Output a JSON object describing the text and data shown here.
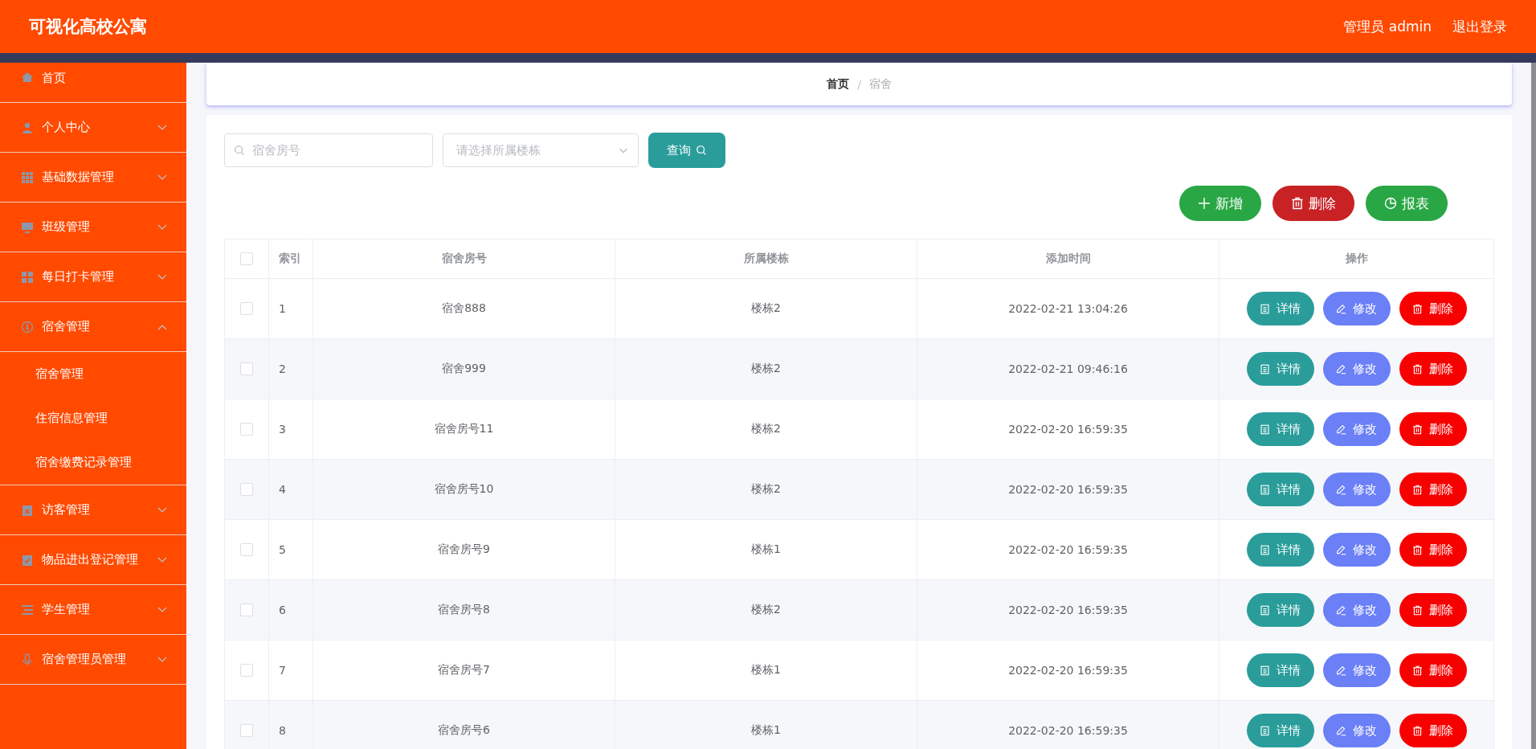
{
  "header": {
    "title": "可视化高校公寓",
    "user": "管理员 admin",
    "logout": "退出登录"
  },
  "sidebar": {
    "items": [
      {
        "label": "首页"
      },
      {
        "label": "个人中心",
        "expanded": false
      },
      {
        "label": "基础数据管理",
        "expanded": false
      },
      {
        "label": "班级管理",
        "expanded": false
      },
      {
        "label": "每日打卡管理",
        "expanded": false
      },
      {
        "label": "宿舍管理",
        "expanded": true,
        "children": [
          {
            "label": "宿舍管理"
          },
          {
            "label": "住宿信息管理"
          },
          {
            "label": "宿舍缴费记录管理"
          }
        ]
      },
      {
        "label": "访客管理",
        "expanded": false
      },
      {
        "label": "物品进出登记管理",
        "expanded": false
      },
      {
        "label": "学生管理",
        "expanded": false
      },
      {
        "label": "宿舍管理员管理",
        "expanded": false
      }
    ]
  },
  "breadcrumb": {
    "items": [
      "首页",
      "宿舍"
    ],
    "separator": "/"
  },
  "search": {
    "room_placeholder": "宿舍房号",
    "building_placeholder": "请选择所属楼栋",
    "query_button": "查询"
  },
  "actions": [
    {
      "label": "新增",
      "kind": "add"
    },
    {
      "label": "删除",
      "kind": "delete"
    },
    {
      "label": "报表",
      "kind": "report"
    }
  ],
  "table": {
    "columns": [
      "索引",
      "宿舍房号",
      "所属楼栋",
      "添加时间",
      "操作"
    ],
    "all_checked": false,
    "rows": [
      {
        "index": "1",
        "room": "宿舍888",
        "building": "楼栋2",
        "time": "2022-02-21 13:04:26",
        "checked": false,
        "buttons": [
          {
            "label": "详情",
            "kind": "detail"
          },
          {
            "label": "修改",
            "kind": "edit"
          },
          {
            "label": "删除",
            "kind": "delete"
          }
        ]
      },
      {
        "index": "2",
        "room": "宿舍999",
        "building": "楼栋2",
        "time": "2022-02-21 09:46:16",
        "checked": false,
        "buttons": [
          {
            "label": "详情",
            "kind": "detail"
          },
          {
            "label": "修改",
            "kind": "edit"
          },
          {
            "label": "删除",
            "kind": "delete"
          }
        ]
      },
      {
        "index": "3",
        "room": "宿舍房号11",
        "building": "楼栋2",
        "time": "2022-02-20 16:59:35",
        "checked": false,
        "buttons": [
          {
            "label": "详情",
            "kind": "detail"
          },
          {
            "label": "修改",
            "kind": "edit"
          },
          {
            "label": "删除",
            "kind": "delete"
          }
        ]
      },
      {
        "index": "4",
        "room": "宿舍房号10",
        "building": "楼栋2",
        "time": "2022-02-20 16:59:35",
        "checked": false,
        "buttons": [
          {
            "label": "详情",
            "kind": "detail"
          },
          {
            "label": "修改",
            "kind": "edit"
          },
          {
            "label": "删除",
            "kind": "delete"
          }
        ]
      },
      {
        "index": "5",
        "room": "宿舍房号9",
        "building": "楼栋1",
        "time": "2022-02-20 16:59:35",
        "checked": false,
        "buttons": [
          {
            "label": "详情",
            "kind": "detail"
          },
          {
            "label": "修改",
            "kind": "edit"
          },
          {
            "label": "删除",
            "kind": "delete"
          }
        ]
      },
      {
        "index": "6",
        "room": "宿舍房号8",
        "building": "楼栋2",
        "time": "2022-02-20 16:59:35",
        "checked": false,
        "buttons": [
          {
            "label": "详情",
            "kind": "detail"
          },
          {
            "label": "修改",
            "kind": "edit"
          },
          {
            "label": "删除",
            "kind": "delete"
          }
        ]
      },
      {
        "index": "7",
        "room": "宿舍房号7",
        "building": "楼栋1",
        "time": "2022-02-20 16:59:35",
        "checked": false,
        "buttons": [
          {
            "label": "详情",
            "kind": "detail"
          },
          {
            "label": "修改",
            "kind": "edit"
          },
          {
            "label": "删除",
            "kind": "delete"
          }
        ]
      },
      {
        "index": "8",
        "room": "宿舍房号6",
        "building": "楼栋1",
        "time": "2022-02-20 16:59:35",
        "checked": false,
        "buttons": [
          {
            "label": "详情",
            "kind": "detail"
          },
          {
            "label": "修改",
            "kind": "edit"
          },
          {
            "label": "删除",
            "kind": "delete"
          }
        ]
      }
    ]
  }
}
